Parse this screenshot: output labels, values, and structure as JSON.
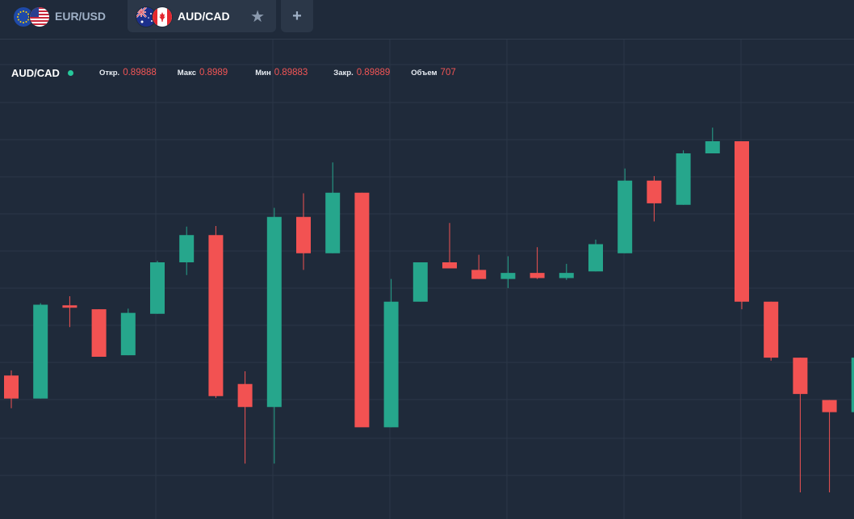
{
  "tabs": [
    {
      "label": "EUR/USD",
      "active": false,
      "flags": [
        "eu-flag-icon",
        "us-flag-icon"
      ]
    },
    {
      "label": "AUD/CAD",
      "active": true,
      "flags": [
        "au-flag-icon",
        "ca-flag-icon"
      ]
    }
  ],
  "add_tab_label": "+",
  "legend": {
    "symbol": "AUD/CAD",
    "open_label": "Откр.",
    "open": "0.89888",
    "high_label": "Макс",
    "high": "0.8989",
    "low_label": "Мин",
    "low": "0.89883",
    "close_label": "Закр.",
    "close": "0.89889",
    "volume_label": "Объем",
    "volume": "707"
  },
  "colors": {
    "background": "#1f2a3a",
    "grid": "#2b3748",
    "up": "#26a68c",
    "down": "#f25252",
    "status_dot": "#26c89b"
  },
  "chart_data": {
    "type": "candlestick",
    "up_color": "#26a68c",
    "down_color": "#f25252",
    "ohlc": [
      {
        "o": 50.6,
        "h": 52.3,
        "l": 39.8,
        "c": 43.0
      },
      {
        "o": 43.0,
        "h": 74.5,
        "l": 43.0,
        "c": 74.0
      },
      {
        "o": 73.8,
        "h": 76.8,
        "l": 66.6,
        "c": 73.0
      },
      {
        "o": 72.5,
        "h": 72.5,
        "l": 56.8,
        "c": 56.8
      },
      {
        "o": 57.3,
        "h": 72.7,
        "l": 57.3,
        "c": 71.3
      },
      {
        "o": 71.0,
        "h": 88.5,
        "l": 71.0,
        "c": 88.0
      },
      {
        "o": 88.0,
        "h": 99.8,
        "l": 83.8,
        "c": 97.0
      },
      {
        "o": 97.0,
        "h": 100.0,
        "l": 43.2,
        "c": 43.8
      },
      {
        "o": 47.8,
        "h": 52.0,
        "l": 21.5,
        "c": 40.2
      },
      {
        "o": 40.2,
        "h": 106.0,
        "l": 21.5,
        "c": 103.0
      },
      {
        "o": 103.0,
        "h": 110.8,
        "l": 85.5,
        "c": 91.0
      },
      {
        "o": 91.0,
        "h": 121.0,
        "l": 91.0,
        "c": 111.0
      },
      {
        "o": 111.0,
        "h": 111.0,
        "l": 34.0,
        "c": 33.5
      },
      {
        "o": 33.5,
        "h": 82.5,
        "l": 33.5,
        "c": 75.0
      },
      {
        "o": 75.0,
        "h": 88.0,
        "l": 75.0,
        "c": 88.0
      },
      {
        "o": 88.0,
        "h": 101.0,
        "l": 86.0,
        "c": 86.0
      },
      {
        "o": 85.5,
        "h": 90.5,
        "l": 82.5,
        "c": 82.5
      },
      {
        "o": 82.5,
        "h": 90.0,
        "l": 79.5,
        "c": 84.5
      },
      {
        "o": 84.5,
        "h": 93.0,
        "l": 82.5,
        "c": 82.8
      },
      {
        "o": 82.8,
        "h": 87.5,
        "l": 82.2,
        "c": 84.5
      },
      {
        "o": 85.0,
        "h": 95.5,
        "l": 85.0,
        "c": 94.0
      },
      {
        "o": 91.0,
        "h": 119.0,
        "l": 91.0,
        "c": 115.0
      },
      {
        "o": 115.0,
        "h": 116.5,
        "l": 101.5,
        "c": 107.5
      },
      {
        "o": 107.0,
        "h": 125.0,
        "l": 107.0,
        "c": 124.0
      },
      {
        "o": 124.0,
        "h": 132.5,
        "l": 124.0,
        "c": 128.0
      },
      {
        "o": 128.0,
        "h": 128.0,
        "l": 72.5,
        "c": 75.0
      },
      {
        "o": 75.0,
        "h": 75.0,
        "l": 55.5,
        "c": 56.5
      },
      {
        "o": 56.5,
        "h": 56.5,
        "l": 12.0,
        "c": 44.5
      },
      {
        "o": 42.5,
        "h": 42.5,
        "l": 12.0,
        "c": 38.5
      },
      {
        "o": 38.5,
        "h": 58.0,
        "l": 38.5,
        "c": 56.5
      }
    ]
  }
}
